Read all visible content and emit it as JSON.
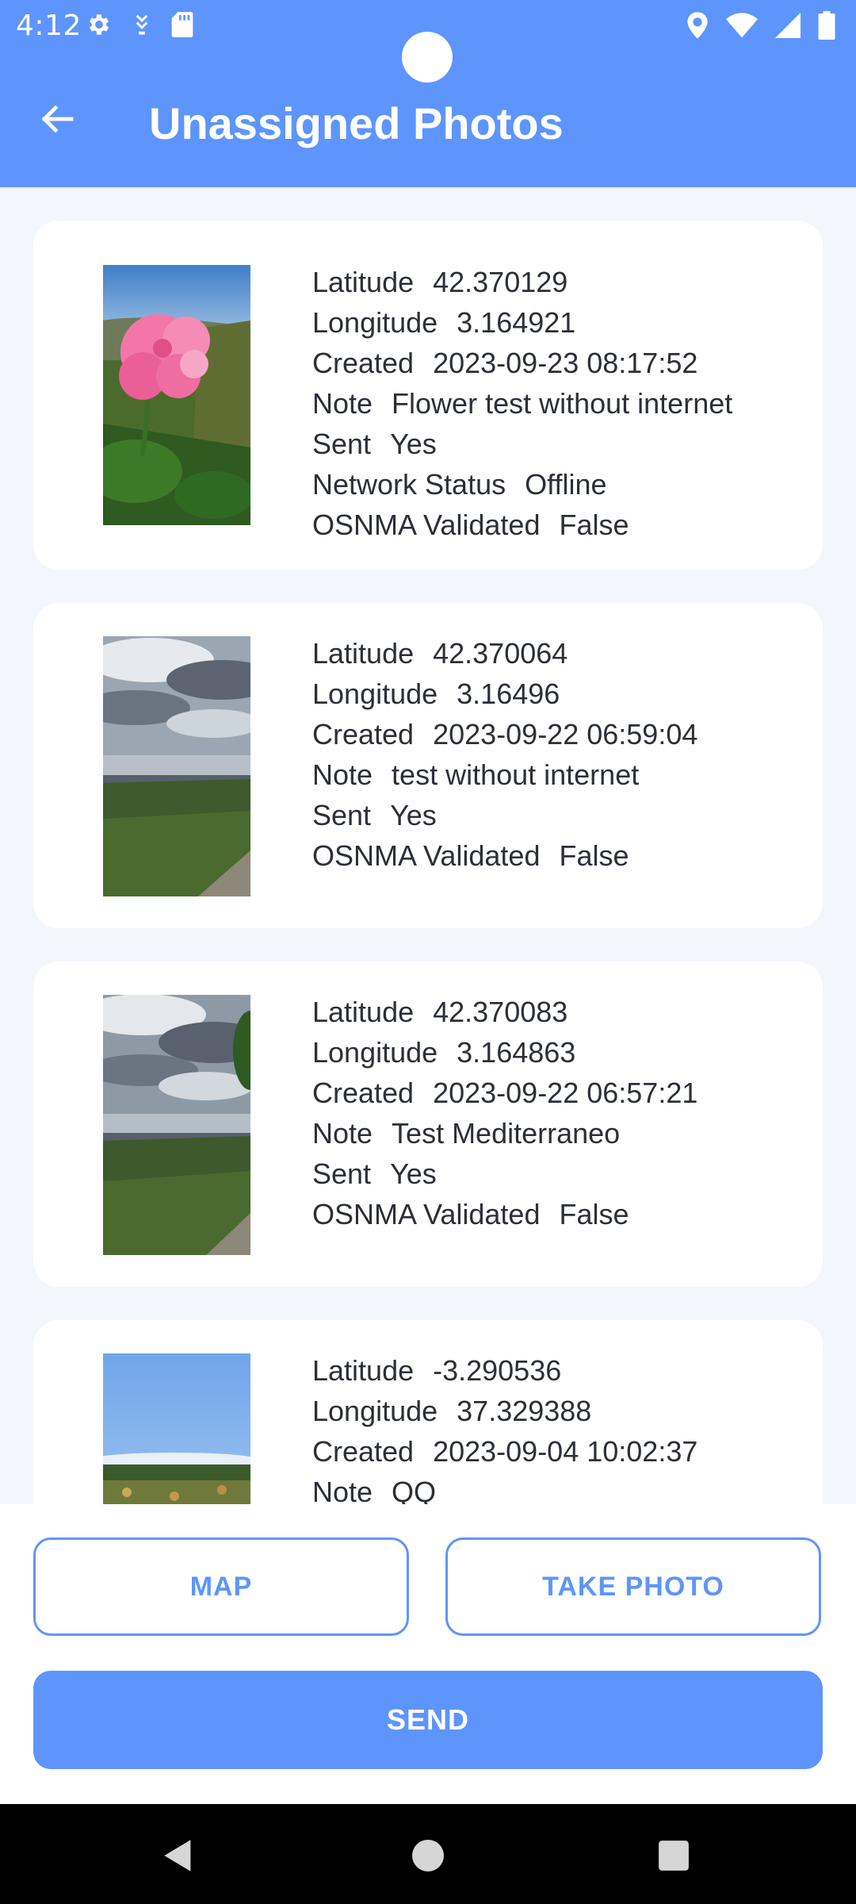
{
  "status_bar": {
    "time": "4:12",
    "left_icons": [
      "settings-icon",
      "debug-icon",
      "sd-card-icon"
    ],
    "right_icons": [
      "location-icon",
      "wifi-icon",
      "signal-icon",
      "battery-icon"
    ]
  },
  "app_bar": {
    "title": "Unassigned Photos",
    "back_icon": "arrow-left-icon"
  },
  "colors": {
    "primary": "#5e95fc",
    "background": "#f3f6fc",
    "card": "#ffffff"
  },
  "photos": [
    {
      "thumbnail": "flower",
      "fields": [
        {
          "label": "Latitude",
          "value": "42.370129"
        },
        {
          "label": "Longitude",
          "value": "3.164921"
        },
        {
          "label": "Created",
          "value": "2023-09-23 08:17:52"
        },
        {
          "label": "Note",
          "value": "Flower test without internet"
        },
        {
          "label": "Sent",
          "value": "Yes"
        },
        {
          "label": "Network Status",
          "value": "Offline"
        },
        {
          "label": "OSNMA Validated",
          "value": "False"
        }
      ]
    },
    {
      "thumbnail": "sea",
      "fields": [
        {
          "label": "Latitude",
          "value": "42.370064"
        },
        {
          "label": "Longitude",
          "value": "3.16496"
        },
        {
          "label": "Created",
          "value": "2023-09-22 06:59:04"
        },
        {
          "label": "Note",
          "value": "test without internet"
        },
        {
          "label": "Sent",
          "value": "Yes"
        },
        {
          "label": "OSNMA Validated",
          "value": "False"
        }
      ]
    },
    {
      "thumbnail": "sea-tree",
      "fields": [
        {
          "label": "Latitude",
          "value": "42.370083"
        },
        {
          "label": "Longitude",
          "value": "3.164863"
        },
        {
          "label": "Created",
          "value": "2023-09-22 06:57:21"
        },
        {
          "label": "Note",
          "value": "Test Mediterraneo"
        },
        {
          "label": "Sent",
          "value": "Yes"
        },
        {
          "label": "OSNMA Validated",
          "value": "False"
        }
      ]
    },
    {
      "thumbnail": "sky",
      "fields": [
        {
          "label": "Latitude",
          "value": "-3.290536"
        },
        {
          "label": "Longitude",
          "value": "37.329388"
        },
        {
          "label": "Created",
          "value": "2023-09-04 10:02:37"
        },
        {
          "label": "Note",
          "value": "QQ"
        }
      ]
    }
  ],
  "actions": {
    "map_label": "MAP",
    "take_photo_label": "TAKE PHOTO",
    "send_label": "SEND"
  },
  "nav_bar": {
    "icons": [
      "nav-back-icon",
      "nav-home-icon",
      "nav-recents-icon"
    ]
  }
}
